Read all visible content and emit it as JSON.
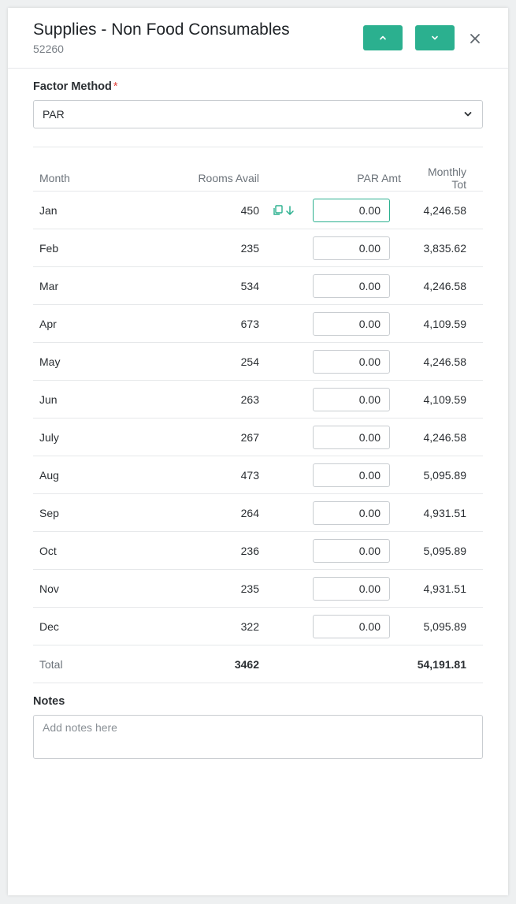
{
  "header": {
    "title": "Supplies - Non Food Consumables",
    "subtitle": "52260"
  },
  "factor": {
    "label": "Factor Method",
    "required_mark": "*",
    "value": "PAR"
  },
  "table": {
    "columns": [
      "Month",
      "Rooms Avail",
      "PAR Amt",
      "Monthly Tot"
    ],
    "rows": [
      {
        "month": "Jan",
        "rooms": "450",
        "par": "0.00",
        "total": "4,246.58"
      },
      {
        "month": "Feb",
        "rooms": "235",
        "par": "0.00",
        "total": "3,835.62"
      },
      {
        "month": "Mar",
        "rooms": "534",
        "par": "0.00",
        "total": "4,246.58"
      },
      {
        "month": "Apr",
        "rooms": "673",
        "par": "0.00",
        "total": "4,109.59"
      },
      {
        "month": "May",
        "rooms": "254",
        "par": "0.00",
        "total": "4,246.58"
      },
      {
        "month": "Jun",
        "rooms": "263",
        "par": "0.00",
        "total": "4,109.59"
      },
      {
        "month": "July",
        "rooms": "267",
        "par": "0.00",
        "total": "4,246.58"
      },
      {
        "month": "Aug",
        "rooms": "473",
        "par": "0.00",
        "total": "5,095.89"
      },
      {
        "month": "Sep",
        "rooms": "264",
        "par": "0.00",
        "total": "4,931.51"
      },
      {
        "month": "Oct",
        "rooms": "236",
        "par": "0.00",
        "total": "5,095.89"
      },
      {
        "month": "Nov",
        "rooms": "235",
        "par": "0.00",
        "total": "4,931.51"
      },
      {
        "month": "Dec",
        "rooms": "322",
        "par": "0.00",
        "total": "5,095.89"
      }
    ],
    "total_row": {
      "label": "Total",
      "rooms": "3462",
      "total": "54,191.81"
    }
  },
  "notes": {
    "label": "Notes",
    "placeholder": "Add notes here"
  },
  "colors": {
    "accent": "#2bb08f",
    "required": "#e0413b"
  },
  "icons": [
    "chevron-up-icon",
    "chevron-down-icon",
    "close-icon",
    "copy-icon",
    "arrow-down-icon"
  ]
}
